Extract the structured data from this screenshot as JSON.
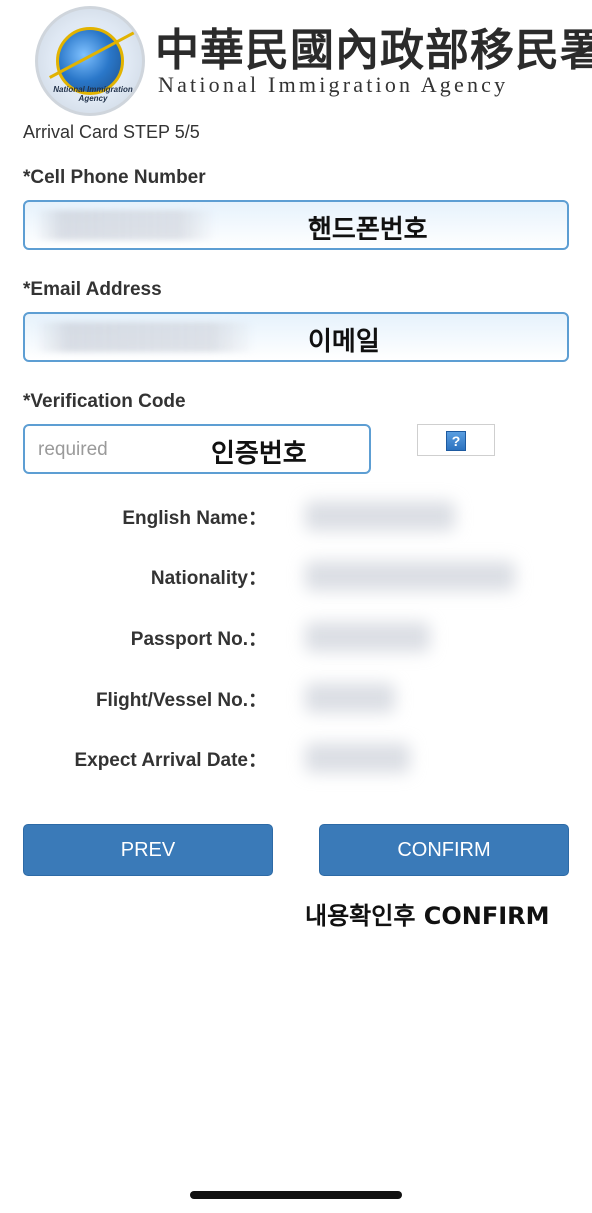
{
  "header": {
    "logo_text": "National Immigration Agency",
    "agency_name_zh": "中華民國內政部移民署",
    "agency_name_en": "National Immigration Agency"
  },
  "form": {
    "step_title": "Arrival Card STEP 5/5",
    "phone": {
      "label": "*Cell Phone Number",
      "overlay_note": "핸드폰번호"
    },
    "email": {
      "label": "*Email Address",
      "overlay_note": "이메일"
    },
    "verification": {
      "label": "*Verification Code",
      "placeholder": "required",
      "overlay_note": "인증번호",
      "help_icon": "question-icon",
      "help_text": "?"
    }
  },
  "info": [
    {
      "label": "English Name："
    },
    {
      "label": "Nationality："
    },
    {
      "label": "Passport No.："
    },
    {
      "label": "Flight/Vessel No.："
    },
    {
      "label": "Expect Arrival Date："
    }
  ],
  "buttons": {
    "prev": "PREV",
    "confirm": "CONFIRM"
  },
  "note": "내용확인후 CONFIRM",
  "colors": {
    "accent": "#3a7ab8",
    "field_border": "#5d9ed3"
  }
}
